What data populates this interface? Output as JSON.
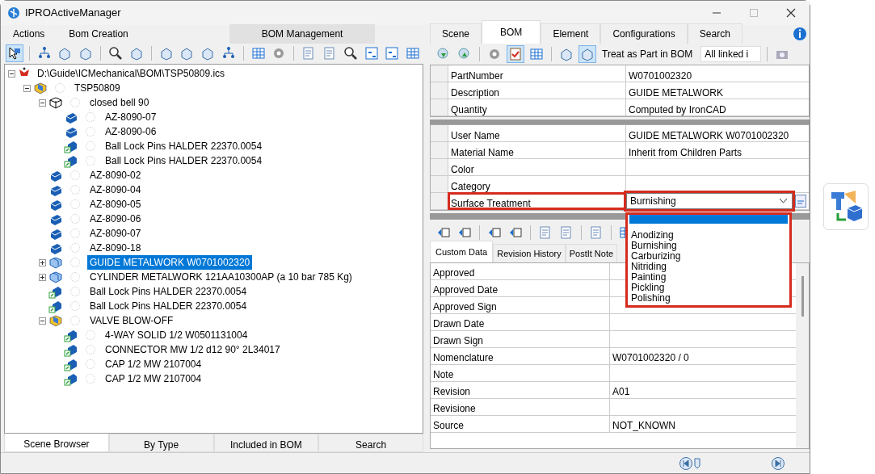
{
  "window": {
    "title": "IPROActiveManager"
  },
  "left_menu": [
    {
      "label": "Actions",
      "selected": false
    },
    {
      "label": "Bom Creation",
      "selected": false
    },
    {
      "label": "BOM Management",
      "selected": true
    }
  ],
  "tree": [
    {
      "label": "D:\\Guide\\ICMechanical\\BOM\\TSP50809.ics",
      "kind": "file",
      "expanded": true,
      "selected": false,
      "children": [
        {
          "label": "TSP50809",
          "kind": "assembly",
          "expanded": true,
          "selected": false,
          "children": [
            {
              "label": "closed bell 90",
              "kind": "group",
              "expanded": true,
              "selected": false,
              "children": [
                {
                  "label": "AZ-8090-07",
                  "kind": "part",
                  "selected": false
                },
                {
                  "label": "AZ-8090-06",
                  "kind": "part",
                  "selected": false
                },
                {
                  "label": "Ball Lock Pins HALDER 22370.0054",
                  "kind": "linked",
                  "selected": false
                },
                {
                  "label": "Ball Lock Pins HALDER 22370.0054",
                  "kind": "linked",
                  "selected": false
                }
              ]
            },
            {
              "label": "AZ-8090-02",
              "kind": "part",
              "selected": false
            },
            {
              "label": "AZ-8090-04",
              "kind": "part",
              "selected": false
            },
            {
              "label": "AZ-8090-05",
              "kind": "part",
              "selected": false
            },
            {
              "label": "AZ-8090-06",
              "kind": "part",
              "selected": false
            },
            {
              "label": "AZ-8090-07",
              "kind": "part",
              "selected": false
            },
            {
              "label": "AZ-8090-18",
              "kind": "part",
              "selected": false
            },
            {
              "label": "GUIDE METALWORK W0701002320",
              "kind": "assembly2",
              "expanded": false,
              "selected": true
            },
            {
              "label": "CYLINDER METALWORK 121AA10300AP (a 10 bar 785 Kg)",
              "kind": "assembly2",
              "expanded": false,
              "selected": false
            },
            {
              "label": "Ball Lock Pins HALDER 22370.0054",
              "kind": "linked",
              "selected": false
            },
            {
              "label": "Ball Lock Pins HALDER 22370.0054",
              "kind": "linked",
              "selected": false
            },
            {
              "label": "VALVE BLOW-OFF",
              "kind": "assembly",
              "expanded": true,
              "selected": false,
              "children": [
                {
                  "label": "4-WAY SOLID 1/2 W0501131004",
                  "kind": "linked",
                  "selected": false
                },
                {
                  "label": "CONNECTOR MW 1/2 d12 90° 2L34017",
                  "kind": "linked",
                  "selected": false
                },
                {
                  "label": "CAP 1/2 MW 2107004",
                  "kind": "linked",
                  "selected": false
                },
                {
                  "label": "CAP 1/2 MW 2107004",
                  "kind": "linked",
                  "selected": false
                }
              ]
            }
          ]
        }
      ]
    }
  ],
  "left_tabs": [
    {
      "label": "Scene Browser",
      "selected": true
    },
    {
      "label": "By Type",
      "selected": false
    },
    {
      "label": "Included in BOM",
      "selected": false
    },
    {
      "label": "Search",
      "selected": false
    }
  ],
  "right_tabs": [
    {
      "label": "Scene",
      "selected": false
    },
    {
      "label": "BOM",
      "selected": true
    },
    {
      "label": "Element",
      "selected": false
    },
    {
      "label": "Configurations",
      "selected": false
    },
    {
      "label": "Search",
      "selected": false
    }
  ],
  "bom_toolbar": {
    "toggle_label": "Treat as Part in BOM",
    "filter_value": "All linked i"
  },
  "properties_main": [
    {
      "name": "PartNumber",
      "value": "W0701002320"
    },
    {
      "name": "Description",
      "value": "GUIDE METALWORK"
    },
    {
      "name": "Quantity",
      "value": "Computed by IronCAD"
    }
  ],
  "properties_user": [
    {
      "name": "User Name",
      "value": "GUIDE METALWORK W0701002320",
      "kind": "text",
      "highlighted": false
    },
    {
      "name": "Material Name",
      "value": "Inherit from Children Parts",
      "kind": "text",
      "highlighted": false
    },
    {
      "name": "Color",
      "kind": "text",
      "highlighted": false
    },
    {
      "name": "Category",
      "kind": "text",
      "highlighted": false
    },
    {
      "name": "Surface Treatment",
      "value": "Burnishing",
      "kind": "combo",
      "highlighted": true
    }
  ],
  "dropdown": {
    "open": true,
    "blank_item_selected": true,
    "items": [
      {
        "label": "Anodizing",
        "selected": false
      },
      {
        "label": "Burnishing",
        "selected": false
      },
      {
        "label": "Carburizing",
        "selected": false
      },
      {
        "label": "Nitriding",
        "selected": false
      },
      {
        "label": "Painting",
        "selected": false
      },
      {
        "label": "Pickling",
        "selected": false
      },
      {
        "label": "Polishing",
        "selected": false
      }
    ]
  },
  "detail_tabs": [
    {
      "label": "Custom Data",
      "selected": true
    },
    {
      "label": "Revision History",
      "selected": false
    },
    {
      "label": "PostIt Note",
      "selected": false
    }
  ],
  "custom_data": [
    {
      "name": "Approved"
    },
    {
      "name": "Approved Date"
    },
    {
      "name": "Approved Sign"
    },
    {
      "name": "Drawn Date"
    },
    {
      "name": "Drawn Sign"
    },
    {
      "name": "Nomenclature",
      "value": "W0701002320 / 0"
    },
    {
      "name": "Note"
    },
    {
      "name": "Revision",
      "value": "A01"
    },
    {
      "name": "Revisione"
    },
    {
      "name": "Source",
      "value": "NOT_KNOWN"
    }
  ]
}
